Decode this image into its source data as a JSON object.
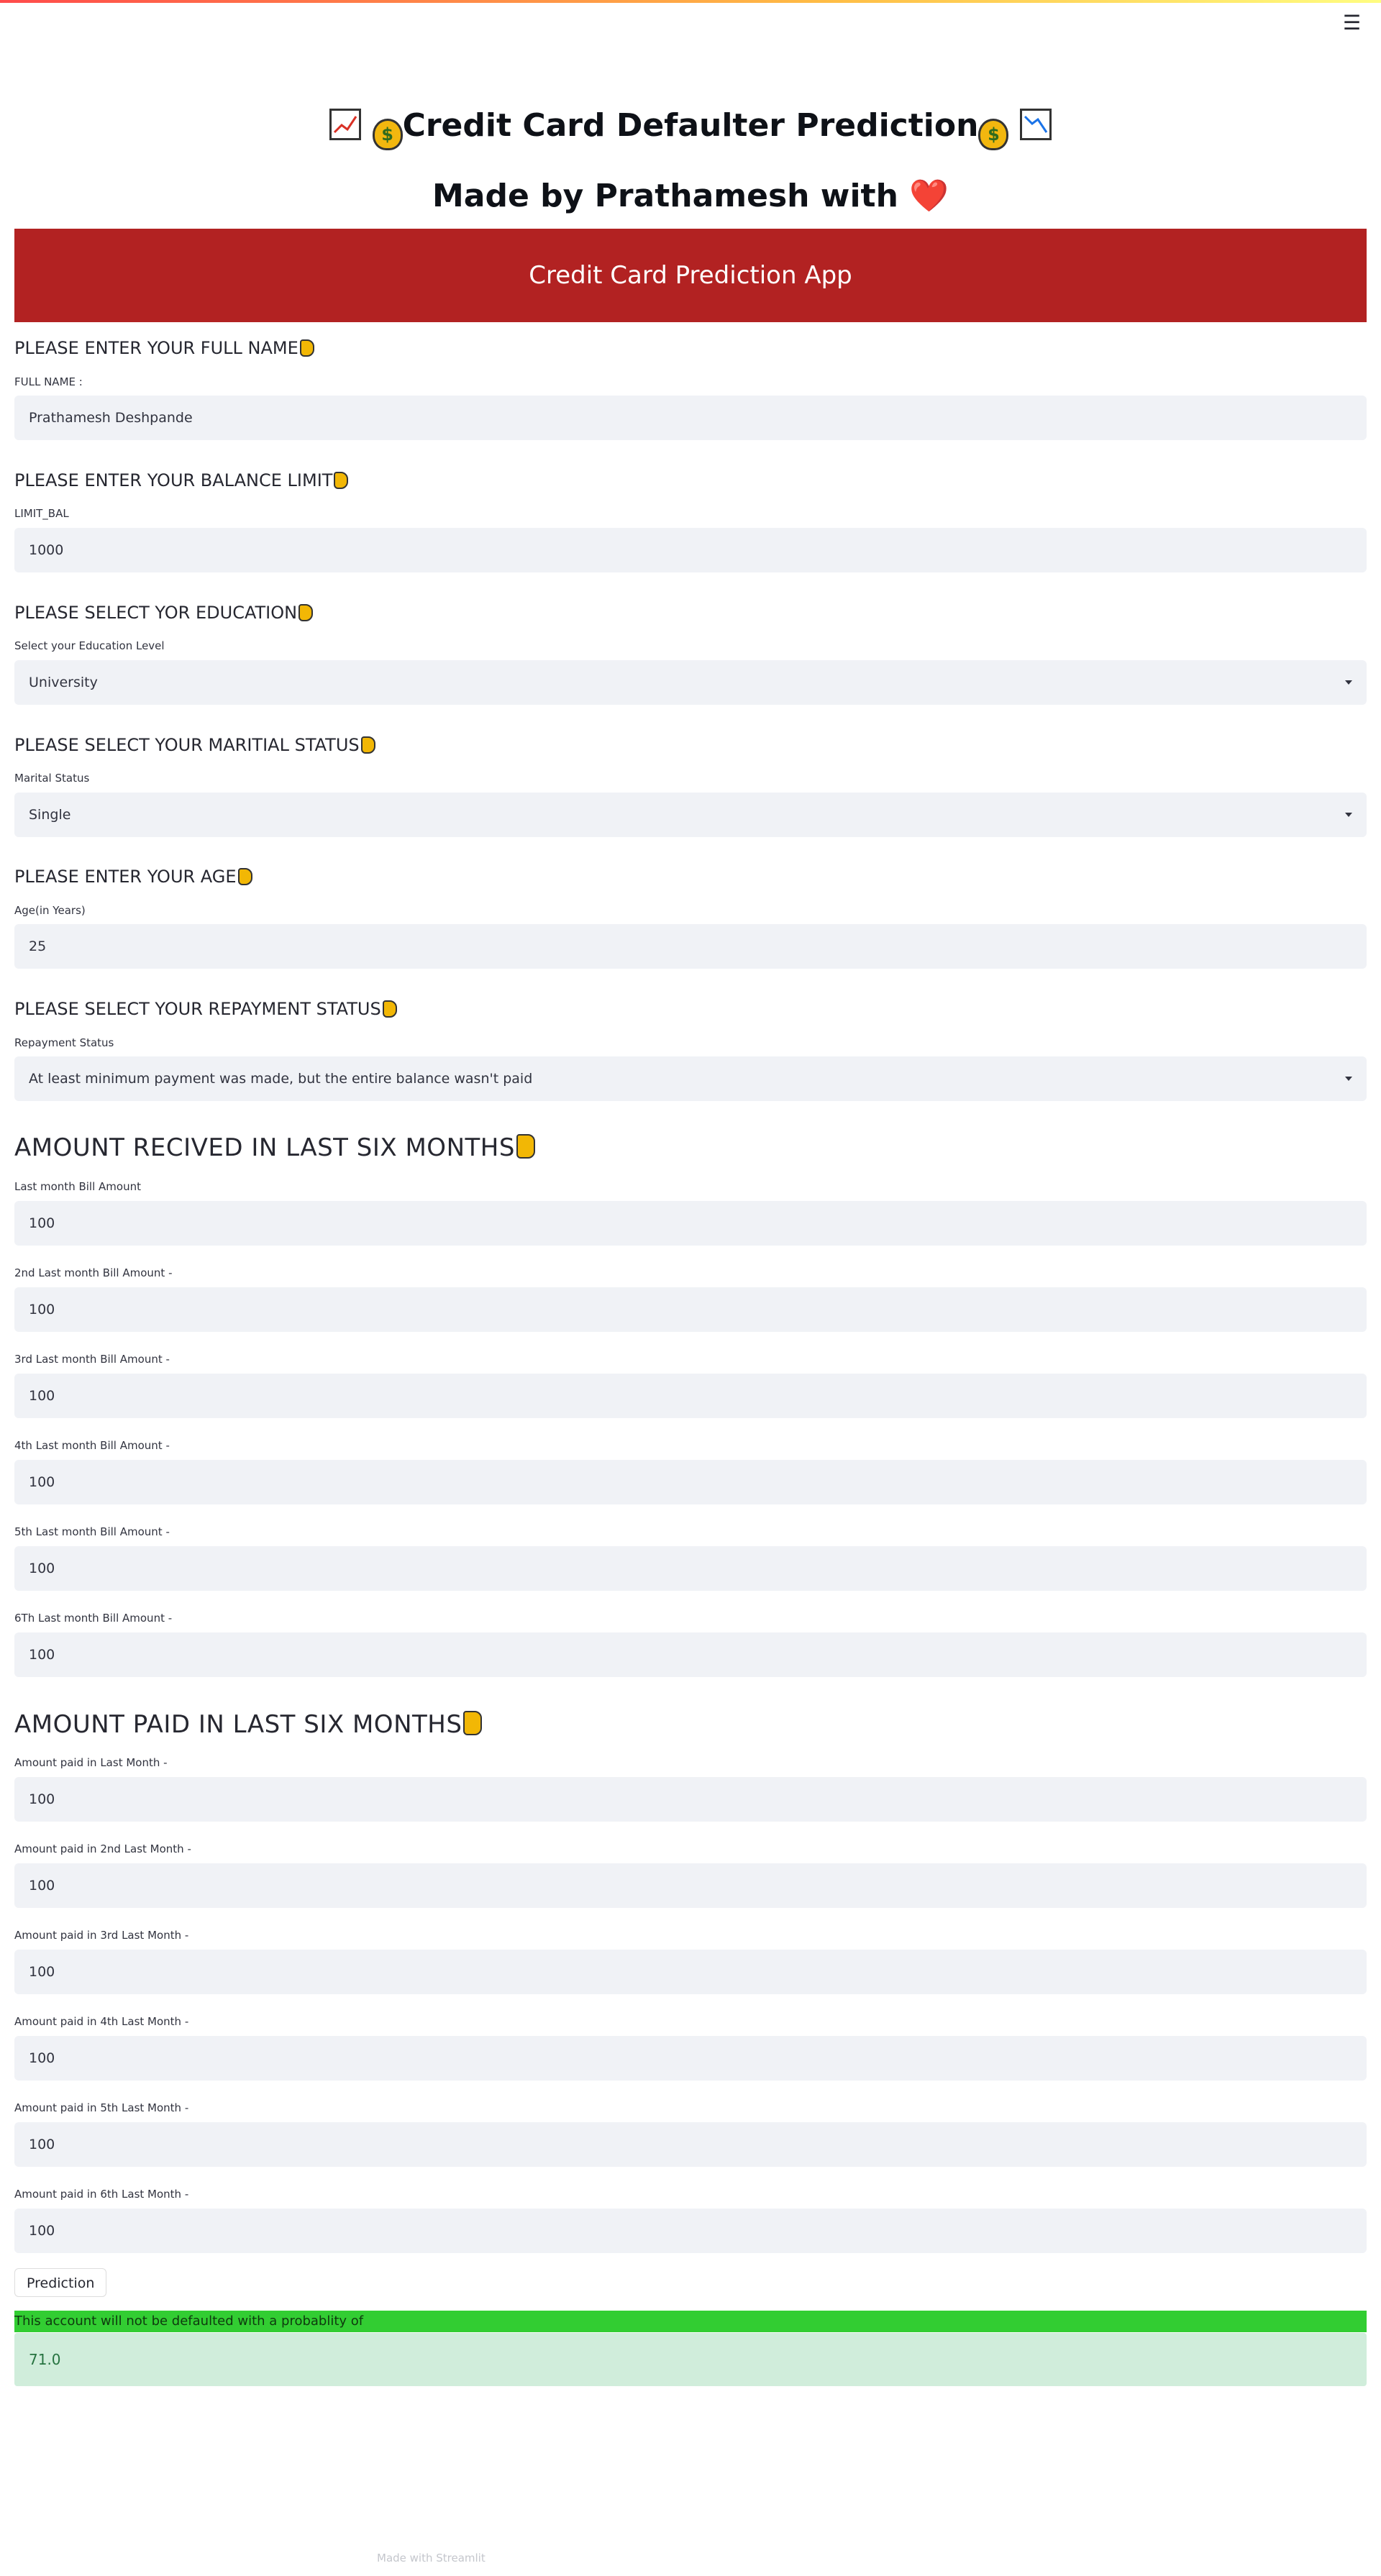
{
  "header": {
    "menu_icon": "☰"
  },
  "title": "Credit Card Defaulter Prediction",
  "subtitle": "Made by Prathamesh with",
  "subtitle_emoji": "❤️",
  "banner": "Credit Card Prediction App",
  "sections": {
    "name": {
      "title": "PLEASE ENTER YOUR FULL NAME",
      "label": "FULL NAME :",
      "value": "Prathamesh Deshpande"
    },
    "limit": {
      "title": "PLEASE ENTER YOUR BALANCE LIMIT",
      "label": "LIMIT_BAL",
      "value": "1000"
    },
    "education": {
      "title": "PLEASE SELECT YOR EDUCATION",
      "label": "Select your Education Level",
      "value": "University"
    },
    "marital": {
      "title": "PLEASE SELECT YOUR MARITIAL STATUS",
      "label": "Marital Status",
      "value": "Single"
    },
    "age": {
      "title": "PLEASE ENTER YOUR AGE",
      "label": "Age(in Years)",
      "value": "25"
    },
    "repayment": {
      "title": "PLEASE SELECT YOUR REPAYMENT STATUS",
      "label": "Repayment Status",
      "value": "At least minimum payment was made, but the entire balance wasn't paid"
    }
  },
  "bill": {
    "title": "AMOUNT RECIVED IN LAST SIX MONTHS",
    "fields": [
      {
        "label": "Last month Bill Amount",
        "value": "100"
      },
      {
        "label": "2nd Last month Bill Amount -",
        "value": "100"
      },
      {
        "label": "3rd Last month Bill Amount -",
        "value": "100"
      },
      {
        "label": "4th Last month Bill Amount -",
        "value": "100"
      },
      {
        "label": "5th Last month Bill Amount -",
        "value": "100"
      },
      {
        "label": "6Th Last month Bill Amount -",
        "value": "100"
      }
    ]
  },
  "paid": {
    "title": "AMOUNT PAID IN LAST SIX MONTHS",
    "fields": [
      {
        "label": "Amount paid in Last Month -",
        "value": "100"
      },
      {
        "label": "Amount paid in 2nd Last Month -",
        "value": "100"
      },
      {
        "label": "Amount paid in 3rd Last Month -",
        "value": "100"
      },
      {
        "label": "Amount paid in 4th Last Month -",
        "value": "100"
      },
      {
        "label": "Amount paid in 5th Last Month -",
        "value": "100"
      },
      {
        "label": "Amount paid in 6th Last Month -",
        "value": "100"
      }
    ]
  },
  "prediction_button": "Prediction",
  "result": {
    "message": "This account will not be defaulted with a probablity of",
    "value": "71.0"
  },
  "footer": "Made with Streamlit",
  "colors": {
    "banner": "#b22222",
    "success_bar": "#32cd32",
    "success_box": "#d0eddb",
    "input_bg": "#f0f2f6"
  }
}
